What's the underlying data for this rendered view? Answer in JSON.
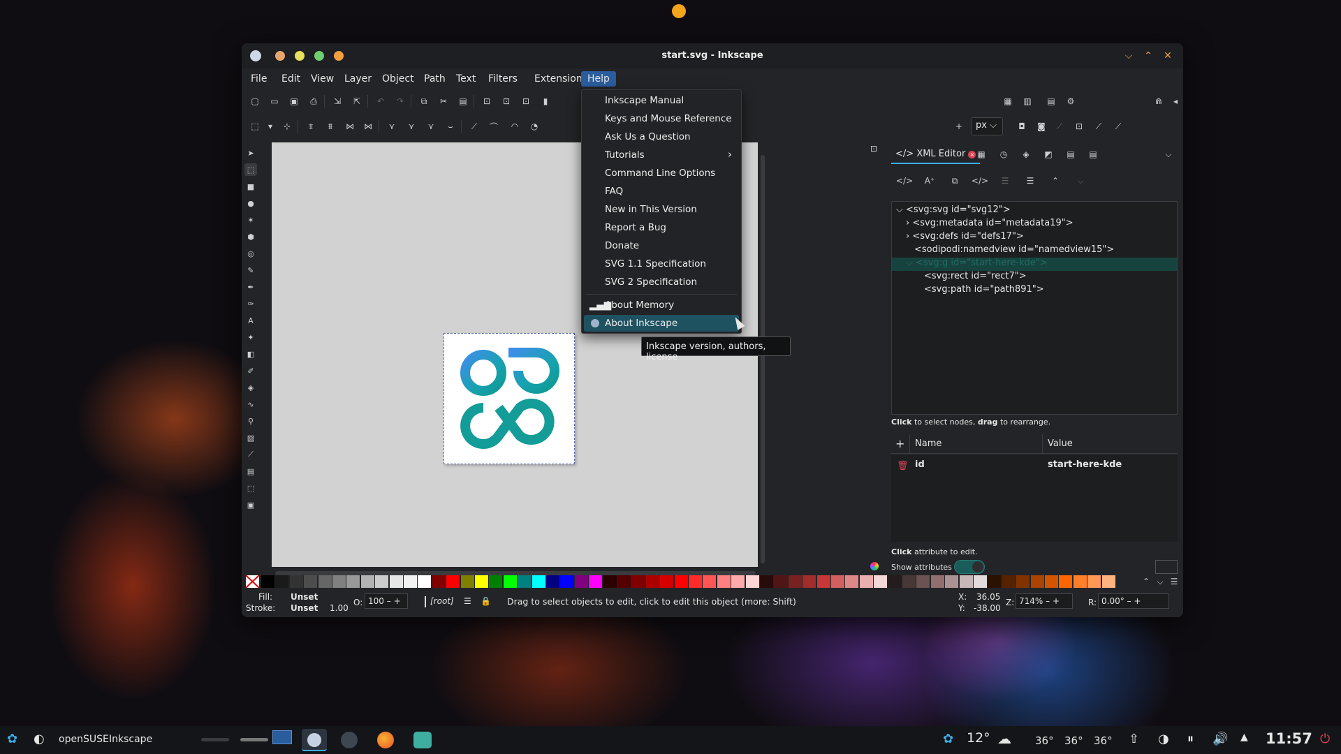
{
  "window": {
    "title": "start.svg - Inkscape",
    "controls": {
      "minimize": "⌵",
      "maximize": "⌃",
      "close": "✕"
    }
  },
  "menubar": [
    "File",
    "Edit",
    "View",
    "Layer",
    "Object",
    "Path",
    "Text",
    "Filters",
    "Extensions",
    "Help"
  ],
  "toolbar": {
    "unit": "px"
  },
  "help_menu": {
    "items": [
      "Inkscape Manual",
      "Keys and Mouse Reference",
      "Ask Us a Question",
      "Tutorials",
      "Command Line Options",
      "FAQ",
      "New in This Version",
      "Report a Bug",
      "Donate",
      "SVG 1.1 Specification",
      "SVG 2 Specification"
    ],
    "about_memory": "About Memory",
    "about_inkscape": "About Inkscape",
    "tooltip": "Inkscape version, authors, license"
  },
  "xml_editor": {
    "tab_label": "XML Editor",
    "tree": [
      "<svg:svg id=\"svg12\">",
      "<svg:metadata id=\"metadata19\">",
      "<svg:defs id=\"defs17\">",
      "<sodipodi:namedview id=\"namedview15\">",
      "<svg:g id=\"start-here-kde\">",
      "<svg:rect id=\"rect7\">",
      "<svg:path id=\"path891\">"
    ],
    "hint_bold1": "Click",
    "hint_mid": " to select nodes, ",
    "hint_bold2": "drag",
    "hint_end": " to rearrange.",
    "col_name": "Name",
    "col_value": "Value",
    "attr_name": "id",
    "attr_value": "start-here-kde",
    "edit_hint_bold": "Click",
    "edit_hint": " attribute to edit.",
    "show_attributes": "Show attributes"
  },
  "statusbar": {
    "fill_label": "Fill:",
    "fill_value": "Unset",
    "stroke_label": "Stroke:",
    "stroke_value": "Unset",
    "stroke_width": "1.00",
    "opacity_label": "O:",
    "opacity_value": "100",
    "layer": "[root]",
    "message": "Drag to select objects to edit, click to edit this object (more: Shift)",
    "x_label": "X:",
    "x_value": "36.05",
    "y_label": "Y:",
    "y_value": "-38.00",
    "zoom_label": "Z:",
    "zoom_value": "714%",
    "rotate_label": "R:",
    "rotate_value": "0.00°"
  },
  "taskbar": {
    "distro": "openSUSE",
    "active_app": "Inkscape",
    "weather": "12°",
    "temps": [
      "36°",
      "36°",
      "36°"
    ],
    "clock": "11:57"
  },
  "palette_colors": [
    "#000000",
    "#1a1a1a",
    "#333333",
    "#4d4d4d",
    "#666666",
    "#808080",
    "#999999",
    "#b3b3b3",
    "#cccccc",
    "#e6e6e6",
    "#f2f2f2",
    "#ffffff",
    "#800000",
    "#ff0000",
    "#808000",
    "#ffff00",
    "#008000",
    "#00ff00",
    "#008080",
    "#00ffff",
    "#000080",
    "#0000ff",
    "#800080",
    "#ff00ff",
    "#2b0000",
    "#550000",
    "#800000",
    "#aa0000",
    "#d40000",
    "#ff0000",
    "#ff2a2a",
    "#ff5555",
    "#ff8080",
    "#ffaaaa",
    "#ffd5d5",
    "#280b0b",
    "#501616",
    "#782121",
    "#a02c2c",
    "#c83737",
    "#d35f5f",
    "#de8787",
    "#e9afaf",
    "#f4d7d7",
    "#241c1c",
    "#483737",
    "#6c5353",
    "#916f6f",
    "#ac9393",
    "#c8b7b7",
    "#e3dbdb",
    "#2b1100",
    "#552200",
    "#803300",
    "#aa4400",
    "#d45500",
    "#ff6600",
    "#ff7f2a",
    "#ff9955",
    "#ffb380"
  ]
}
